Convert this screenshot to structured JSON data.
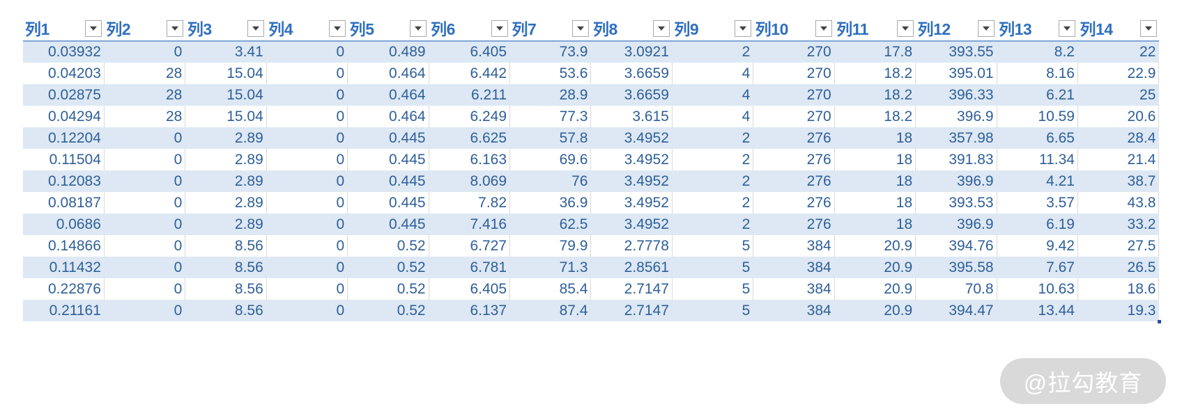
{
  "table": {
    "headers": [
      "列1",
      "列2",
      "列3",
      "列4",
      "列5",
      "列6",
      "列7",
      "列8",
      "列9",
      "列10",
      "列11",
      "列12",
      "列13",
      "列14"
    ],
    "rows": [
      [
        "0.03932",
        "0",
        "3.41",
        "0",
        "0.489",
        "6.405",
        "73.9",
        "3.0921",
        "2",
        "270",
        "17.8",
        "393.55",
        "8.2",
        "22"
      ],
      [
        "0.04203",
        "28",
        "15.04",
        "0",
        "0.464",
        "6.442",
        "53.6",
        "3.6659",
        "4",
        "270",
        "18.2",
        "395.01",
        "8.16",
        "22.9"
      ],
      [
        "0.02875",
        "28",
        "15.04",
        "0",
        "0.464",
        "6.211",
        "28.9",
        "3.6659",
        "4",
        "270",
        "18.2",
        "396.33",
        "6.21",
        "25"
      ],
      [
        "0.04294",
        "28",
        "15.04",
        "0",
        "0.464",
        "6.249",
        "77.3",
        "3.615",
        "4",
        "270",
        "18.2",
        "396.9",
        "10.59",
        "20.6"
      ],
      [
        "0.12204",
        "0",
        "2.89",
        "0",
        "0.445",
        "6.625",
        "57.8",
        "3.4952",
        "2",
        "276",
        "18",
        "357.98",
        "6.65",
        "28.4"
      ],
      [
        "0.11504",
        "0",
        "2.89",
        "0",
        "0.445",
        "6.163",
        "69.6",
        "3.4952",
        "2",
        "276",
        "18",
        "391.83",
        "11.34",
        "21.4"
      ],
      [
        "0.12083",
        "0",
        "2.89",
        "0",
        "0.445",
        "8.069",
        "76",
        "3.4952",
        "2",
        "276",
        "18",
        "396.9",
        "4.21",
        "38.7"
      ],
      [
        "0.08187",
        "0",
        "2.89",
        "0",
        "0.445",
        "7.82",
        "36.9",
        "3.4952",
        "2",
        "276",
        "18",
        "393.53",
        "3.57",
        "43.8"
      ],
      [
        "0.0686",
        "0",
        "2.89",
        "0",
        "0.445",
        "7.416",
        "62.5",
        "3.4952",
        "2",
        "276",
        "18",
        "396.9",
        "6.19",
        "33.2"
      ],
      [
        "0.14866",
        "0",
        "8.56",
        "0",
        "0.52",
        "6.727",
        "79.9",
        "2.7778",
        "5",
        "384",
        "20.9",
        "394.76",
        "9.42",
        "27.5"
      ],
      [
        "0.11432",
        "0",
        "8.56",
        "0",
        "0.52",
        "6.781",
        "71.3",
        "2.8561",
        "5",
        "384",
        "20.9",
        "395.58",
        "7.67",
        "26.5"
      ],
      [
        "0.22876",
        "0",
        "8.56",
        "0",
        "0.52",
        "6.405",
        "85.4",
        "2.7147",
        "5",
        "384",
        "20.9",
        "70.8",
        "10.63",
        "18.6"
      ],
      [
        "0.21161",
        "0",
        "8.56",
        "0",
        "0.52",
        "6.137",
        "87.4",
        "2.7147",
        "5",
        "384",
        "20.9",
        "394.47",
        "13.44",
        "19.3"
      ]
    ]
  },
  "watermark": {
    "text": "@拉勾教育"
  },
  "colors": {
    "header_text": "#2f6fc0",
    "cell_text": "#2e5f99",
    "band_fill": "#dde8f4",
    "header_rule": "#7fa7d6"
  }
}
